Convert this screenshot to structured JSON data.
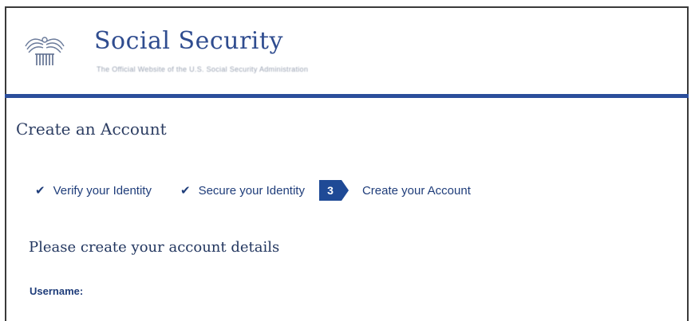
{
  "header": {
    "brand_title": "Social Security",
    "brand_subtitle": "The Official Website of the U.S. Social Security Administration",
    "logo_icon": "eagle-seal-icon",
    "accent_color": "#2b4e9b"
  },
  "page": {
    "title": "Create an Account"
  },
  "steps": [
    {
      "number": "",
      "label": "Verify your Identity",
      "status": "complete",
      "icon": "check-icon"
    },
    {
      "number": "",
      "label": "Secure your Identity",
      "status": "complete",
      "icon": "check-icon"
    },
    {
      "number": "3",
      "label": "Create your Account",
      "status": "current",
      "icon": ""
    }
  ],
  "form": {
    "heading": "Please create your account details",
    "username_label": "Username:"
  }
}
